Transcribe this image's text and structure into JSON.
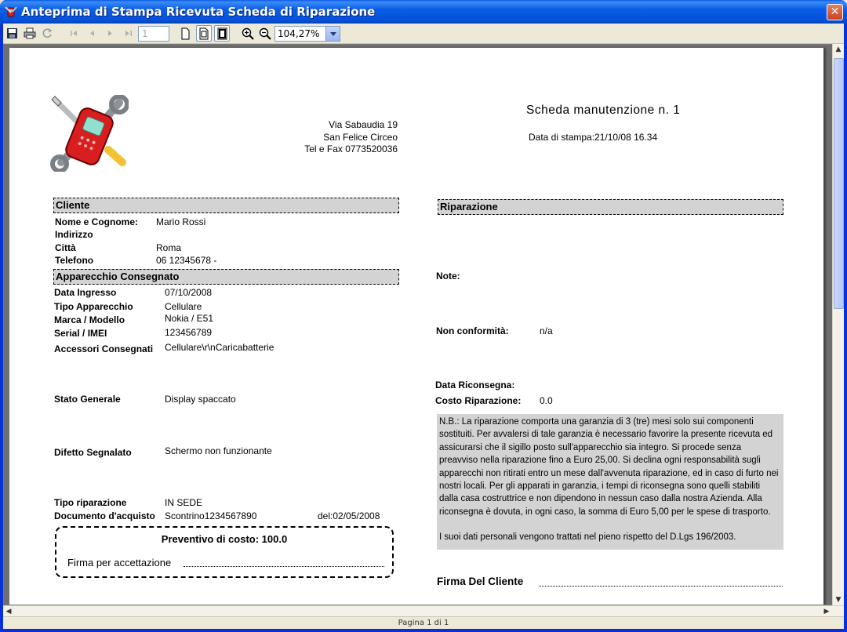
{
  "window": {
    "title": "Anteprima di Stampa Ricevuta Scheda di Riparazione",
    "close_label": "✕"
  },
  "toolbar": {
    "page_number": "1",
    "zoom": "104,27%"
  },
  "status": {
    "page_label": "Pagina 1 di 1"
  },
  "company": {
    "address": "Via Sabaudia 19",
    "city": "San Felice Circeo",
    "phone": "Tel e Fax 0773520036"
  },
  "header": {
    "title": "Scheda manutenzione n. 1",
    "print_date": "Data di stampa:21/10/08 16.34"
  },
  "cliente": {
    "section": "Cliente",
    "fields": [
      {
        "label": "Nome e Cognome:",
        "value": "Mario Rossi"
      },
      {
        "label": "Indirizzo",
        "value": ""
      },
      {
        "label": "Città",
        "value": "Roma"
      },
      {
        "label": "Telefono",
        "value": "06 12345678 -"
      }
    ]
  },
  "apparecchio": {
    "section": "Apparecchio Consegnato",
    "data_ingresso": {
      "label": "Data Ingresso",
      "value": "07/10/2008"
    },
    "tipo": {
      "label": "Tipo Apparecchio",
      "value": "Cellulare"
    },
    "marca": {
      "label": "Marca / Modello",
      "value": "Nokia / E51"
    },
    "serial": {
      "label": "Serial / IMEI",
      "value": "123456789"
    },
    "accessori": {
      "label": "Accessori Consegnati",
      "value": "Cellulare\\r\\nCaricabatterie"
    },
    "stato": {
      "label": "Stato Generale",
      "value": "Display spaccato"
    },
    "difetto": {
      "label": "Difetto Segnalato",
      "value": "Schermo non funzionante"
    },
    "tipo_riparazione": {
      "label": "Tipo riparazione",
      "value": "IN SEDE"
    },
    "documento": {
      "label": "Documento d'acquisto",
      "value": "Scontrino1234567890",
      "date": "del:02/05/2008"
    }
  },
  "preventivo": {
    "title": "Preventivo di costo: 100.0",
    "firma_label": "Firma per accettazione"
  },
  "riparazione": {
    "section": "Riparazione",
    "note_label": "Note:",
    "non_conf_label": "Non conformità:",
    "non_conf_value": "n/a",
    "riconsegna_label": "Data Riconsegna:",
    "costo_label": "Costo Riparazione:",
    "costo_value": "0.0",
    "nb_text": "N.B.: La riparazione comporta una garanzia di 3 (tre) mesi solo sui componenti sostituiti. Per avvalersi di tale garanzia è necessario favorire la presente ricevuta ed assicurarsi che il sigillo posto sull'apparecchio sia integro. Si procede senza preavviso nella riparazione fino a Euro 25,00. Si declina ogni responsabilità sugli apparecchi non ritirati entro un mese dall'avvenuta riparazione, ed in caso di furto nei nostri locali. Per gli apparati in garanzia, i tempi di riconsegna sono quelli stabiliti dalla casa costruttrice e non dipendono in nessun caso dalla nostra Azienda. Alla riconsegna è dovuta, in ogni caso, la somma di Euro 5,00 per le spese di trasporto.",
    "privacy_text": "I suoi dati personali vengono trattati nel pieno rispetto del D.Lgs 196/2003.",
    "firma_cliente_label": "Firma Del Cliente"
  },
  "icons": [
    "tools-phone-icon",
    "save-icon",
    "print-icon",
    "refresh-icon",
    "first-page-icon",
    "prev-page-icon",
    "next-page-icon",
    "last-page-icon",
    "single-page-icon",
    "page-width-icon",
    "full-page-icon",
    "zoom-in-icon",
    "zoom-out-icon"
  ]
}
